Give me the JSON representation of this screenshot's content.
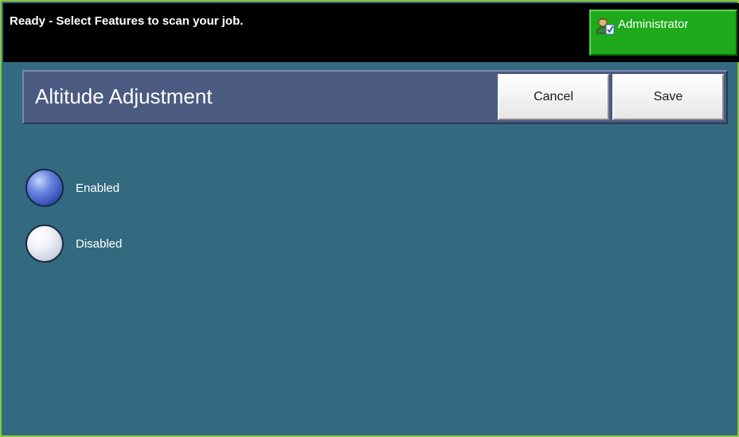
{
  "status_bar": {
    "message": "Ready - Select Features to scan your job."
  },
  "admin": {
    "label": "Administrator",
    "icon": "administrator-icon"
  },
  "header": {
    "title": "Altitude Adjustment",
    "cancel_label": "Cancel",
    "save_label": "Save"
  },
  "options": [
    {
      "label": "Enabled",
      "selected": true
    },
    {
      "label": "Disabled",
      "selected": false
    }
  ],
  "colors": {
    "frame_border": "#8cc63f",
    "background": "#336a80",
    "title_bar": "#4b5a80",
    "admin_green": "#1eaa1a"
  }
}
